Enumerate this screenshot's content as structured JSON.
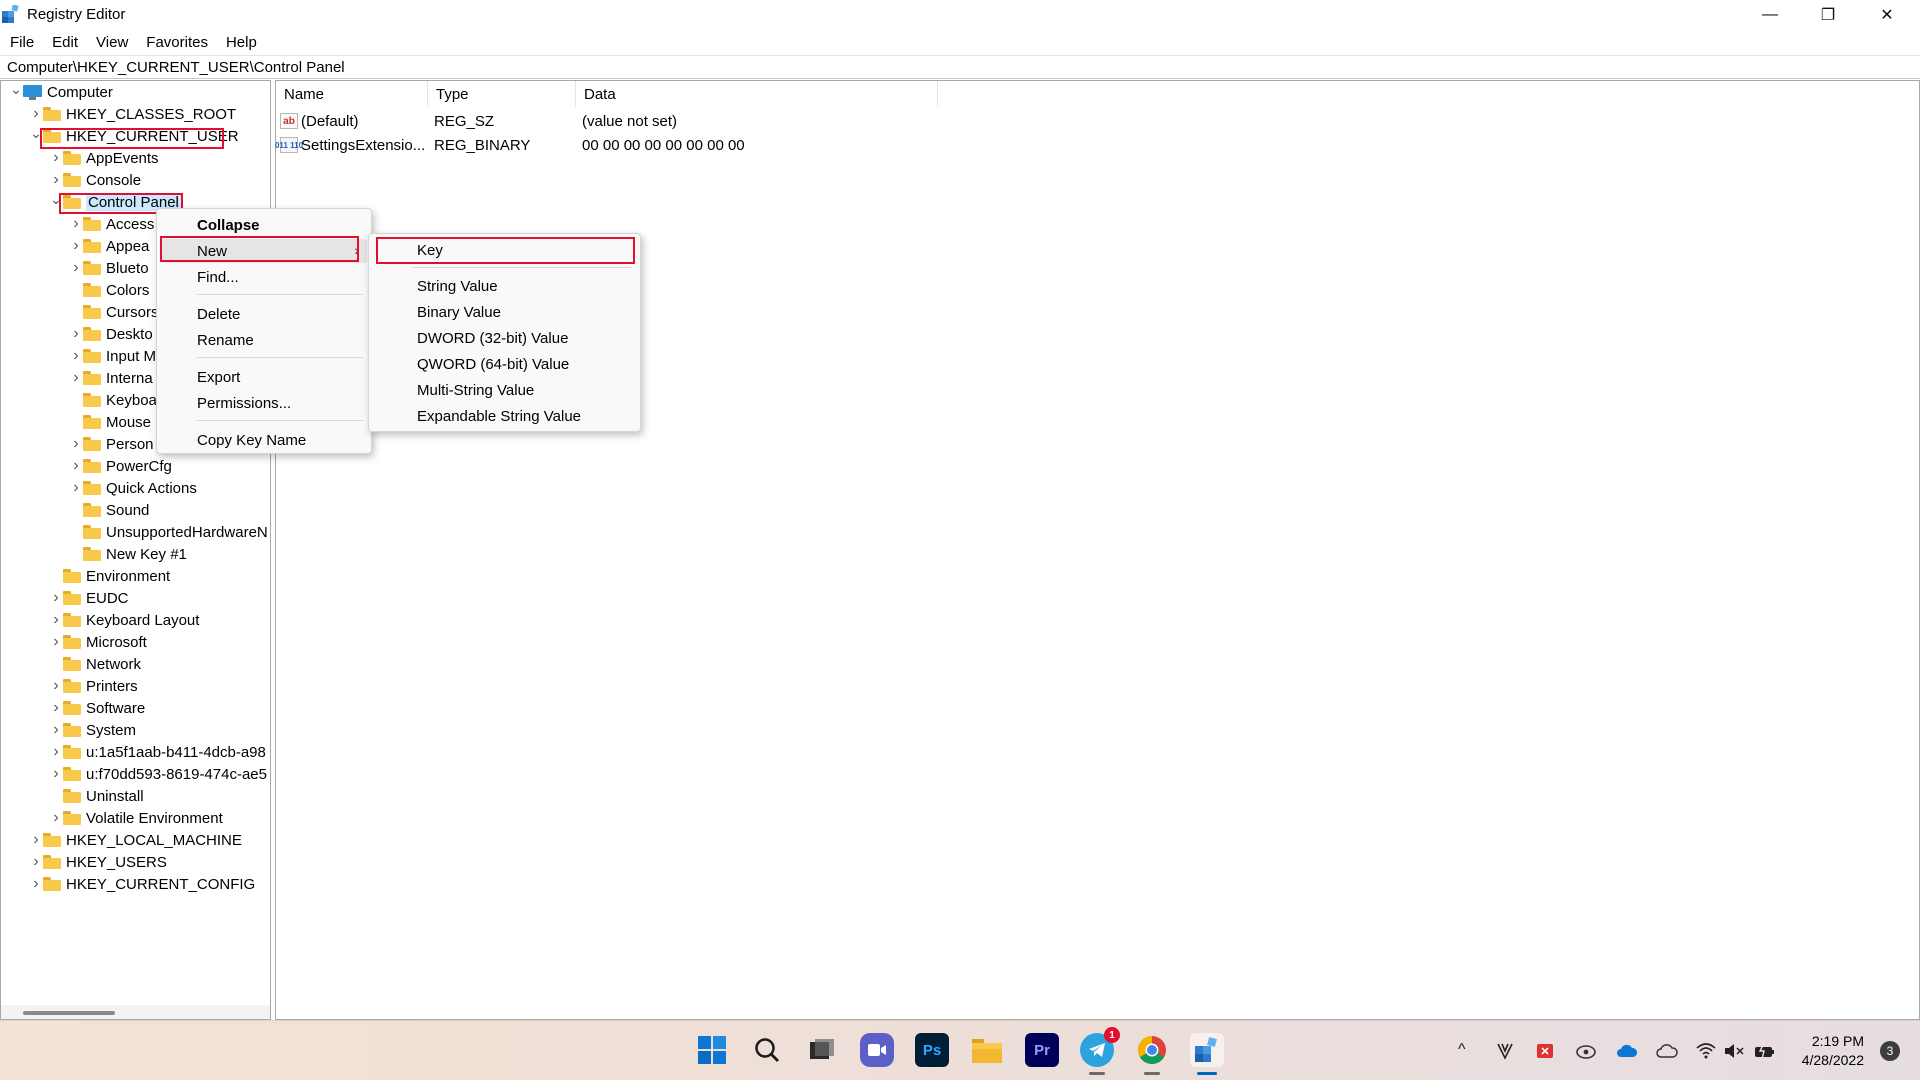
{
  "window": {
    "title": "Registry Editor",
    "minimize_glyph": "—",
    "maximize_glyph": "❐",
    "close_glyph": "✕"
  },
  "menubar": {
    "items": [
      "File",
      "Edit",
      "View",
      "Favorites",
      "Help"
    ]
  },
  "address": {
    "path": "Computer\\HKEY_CURRENT_USER\\Control Panel"
  },
  "tree": {
    "items": [
      {
        "label": "Computer",
        "depth": 0,
        "expander": "open",
        "icon": "computer-icon"
      },
      {
        "label": "HKEY_CLASSES_ROOT",
        "depth": 1,
        "expander": "closed",
        "icon": "folder-icon"
      },
      {
        "label": "HKEY_CURRENT_USER",
        "depth": 1,
        "expander": "open",
        "icon": "folder-icon",
        "highlighted": true
      },
      {
        "label": "AppEvents",
        "depth": 2,
        "expander": "closed",
        "icon": "folder-icon"
      },
      {
        "label": "Console",
        "depth": 2,
        "expander": "closed",
        "icon": "folder-icon"
      },
      {
        "label": "Control Panel",
        "depth": 2,
        "expander": "open",
        "icon": "folder-icon",
        "highlighted": true,
        "selected": true
      },
      {
        "label": "Access",
        "depth": 3,
        "expander": "closed",
        "icon": "folder-icon"
      },
      {
        "label": "Appea",
        "depth": 3,
        "expander": "closed",
        "icon": "folder-icon"
      },
      {
        "label": "Blueto",
        "depth": 3,
        "expander": "closed",
        "icon": "folder-icon"
      },
      {
        "label": "Colors",
        "depth": 3,
        "expander": "none",
        "icon": "folder-icon"
      },
      {
        "label": "Cursors",
        "depth": 3,
        "expander": "none",
        "icon": "folder-icon"
      },
      {
        "label": "Deskto",
        "depth": 3,
        "expander": "closed",
        "icon": "folder-icon"
      },
      {
        "label": "Input M",
        "depth": 3,
        "expander": "closed",
        "icon": "folder-icon"
      },
      {
        "label": "Interna",
        "depth": 3,
        "expander": "closed",
        "icon": "folder-icon"
      },
      {
        "label": "Keyboa",
        "depth": 3,
        "expander": "none",
        "icon": "folder-icon"
      },
      {
        "label": "Mouse",
        "depth": 3,
        "expander": "none",
        "icon": "folder-icon"
      },
      {
        "label": "Person",
        "depth": 3,
        "expander": "closed",
        "icon": "folder-icon"
      },
      {
        "label": "PowerCfg",
        "depth": 3,
        "expander": "closed",
        "icon": "folder-icon"
      },
      {
        "label": "Quick Actions",
        "depth": 3,
        "expander": "closed",
        "icon": "folder-icon"
      },
      {
        "label": "Sound",
        "depth": 3,
        "expander": "none",
        "icon": "folder-icon"
      },
      {
        "label": "UnsupportedHardwareN",
        "depth": 3,
        "expander": "none",
        "icon": "folder-icon"
      },
      {
        "label": "New Key #1",
        "depth": 3,
        "expander": "none",
        "icon": "folder-icon"
      },
      {
        "label": "Environment",
        "depth": 2,
        "expander": "none",
        "icon": "folder-icon"
      },
      {
        "label": "EUDC",
        "depth": 2,
        "expander": "closed",
        "icon": "folder-icon"
      },
      {
        "label": "Keyboard Layout",
        "depth": 2,
        "expander": "closed",
        "icon": "folder-icon"
      },
      {
        "label": "Microsoft",
        "depth": 2,
        "expander": "closed",
        "icon": "folder-icon"
      },
      {
        "label": "Network",
        "depth": 2,
        "expander": "none",
        "icon": "folder-icon"
      },
      {
        "label": "Printers",
        "depth": 2,
        "expander": "closed",
        "icon": "folder-icon"
      },
      {
        "label": "Software",
        "depth": 2,
        "expander": "closed",
        "icon": "folder-icon"
      },
      {
        "label": "System",
        "depth": 2,
        "expander": "closed",
        "icon": "folder-icon"
      },
      {
        "label": "u:1a5f1aab-b411-4dcb-a98",
        "depth": 2,
        "expander": "closed",
        "icon": "folder-icon"
      },
      {
        "label": "u:f70dd593-8619-474c-ae5",
        "depth": 2,
        "expander": "closed",
        "icon": "folder-icon"
      },
      {
        "label": "Uninstall",
        "depth": 2,
        "expander": "none",
        "icon": "folder-icon"
      },
      {
        "label": "Volatile Environment",
        "depth": 2,
        "expander": "closed",
        "icon": "folder-icon"
      },
      {
        "label": "HKEY_LOCAL_MACHINE",
        "depth": 1,
        "expander": "closed",
        "icon": "folder-icon"
      },
      {
        "label": "HKEY_USERS",
        "depth": 1,
        "expander": "closed",
        "icon": "folder-icon"
      },
      {
        "label": "HKEY_CURRENT_CONFIG",
        "depth": 1,
        "expander": "closed",
        "icon": "folder-icon"
      }
    ]
  },
  "list": {
    "columns": [
      "Name",
      "Type",
      "Data"
    ],
    "rows": [
      {
        "icon": "string-value-icon",
        "icon_text": "ab",
        "name": "(Default)",
        "type": "REG_SZ",
        "data": "(value not set)"
      },
      {
        "icon": "binary-value-icon",
        "icon_text": "011 110",
        "name": "SettingsExtensio...",
        "type": "REG_BINARY",
        "data": "00 00 00 00 00 00 00 00"
      }
    ]
  },
  "context_menu": {
    "items": [
      {
        "label": "Collapse",
        "bold": true
      },
      {
        "label": "New",
        "submenu": true,
        "highlighted": true
      },
      {
        "label": "Find..."
      },
      {
        "label": "Delete"
      },
      {
        "label": "Rename"
      },
      {
        "label": "Export"
      },
      {
        "label": "Permissions..."
      },
      {
        "label": "Copy Key Name"
      }
    ],
    "submenu_arrow": "›"
  },
  "submenu": {
    "items": [
      {
        "label": "Key",
        "highlighted": true
      },
      {
        "label": "String Value"
      },
      {
        "label": "Binary Value"
      },
      {
        "label": "DWORD (32-bit) Value"
      },
      {
        "label": "QWORD (64-bit) Value"
      },
      {
        "label": "Multi-String Value"
      },
      {
        "label": "Expandable String Value"
      }
    ]
  },
  "taskbar": {
    "apps": [
      {
        "name": "start-icon",
        "label": ""
      },
      {
        "name": "search-icon",
        "label": ""
      },
      {
        "name": "task-view-icon",
        "label": ""
      },
      {
        "name": "teams-chat-icon",
        "label": ""
      },
      {
        "name": "photoshop-icon",
        "label": "Ps"
      },
      {
        "name": "file-explorer-icon",
        "label": ""
      },
      {
        "name": "premiere-icon",
        "label": "Pr"
      },
      {
        "name": "telegram-icon",
        "label": "",
        "badge": "1"
      },
      {
        "name": "chrome-icon",
        "label": ""
      },
      {
        "name": "registry-editor-icon",
        "label": ""
      }
    ],
    "tray": {
      "chevron": "^",
      "time": "2:19 PM",
      "date": "4/28/2022",
      "notifications": "3"
    }
  },
  "colors": {
    "highlight_border": "#e0102e",
    "folder": "#f8c94a",
    "accent": "#0067c0"
  }
}
